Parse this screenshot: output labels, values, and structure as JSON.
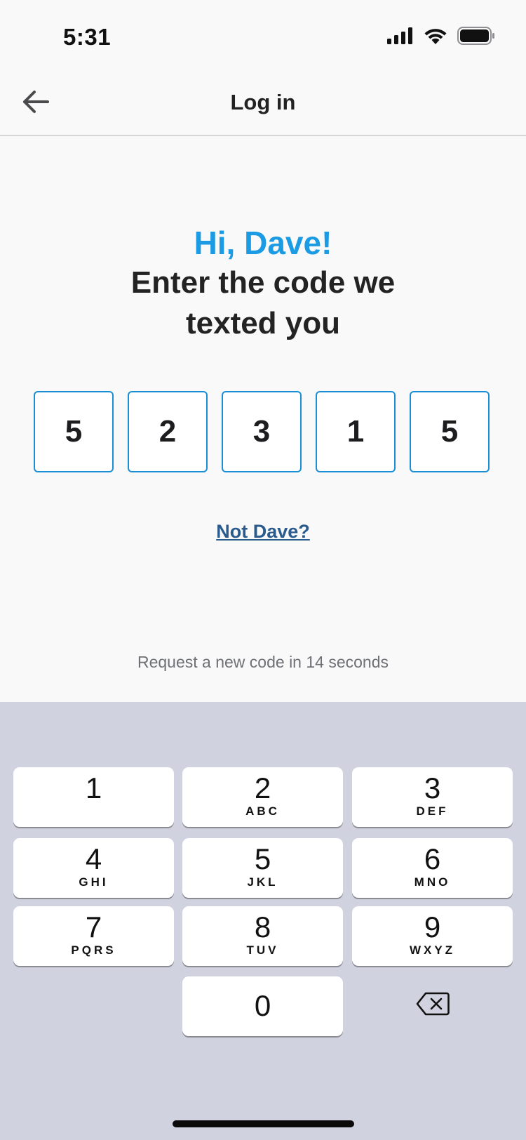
{
  "status_bar": {
    "time": "5:31",
    "icons": [
      "cellular-signal-icon",
      "wifi-icon",
      "battery-icon"
    ]
  },
  "nav": {
    "title": "Log in",
    "back_icon": "arrow-left-icon"
  },
  "heading": {
    "greeting": "Hi, Dave!",
    "instruction": "Enter the code we texted you"
  },
  "code": {
    "digits": [
      "5",
      "2",
      "3",
      "1",
      "5"
    ]
  },
  "not_user_link": "Not Dave?",
  "resend_text": "Request a new code in 14 seconds",
  "keyboard": {
    "keys": [
      {
        "digit": "1",
        "letters": ""
      },
      {
        "digit": "2",
        "letters": "ABC"
      },
      {
        "digit": "3",
        "letters": "DEF"
      },
      {
        "digit": "4",
        "letters": "GHI"
      },
      {
        "digit": "5",
        "letters": "JKL"
      },
      {
        "digit": "6",
        "letters": "MNO"
      },
      {
        "digit": "7",
        "letters": "PQRS"
      },
      {
        "digit": "8",
        "letters": "TUV"
      },
      {
        "digit": "9",
        "letters": "WXYZ"
      },
      {
        "digit": "0",
        "letters": ""
      }
    ],
    "delete_icon": "backspace-icon"
  },
  "colors": {
    "accent": "#1a9be3",
    "link": "#2a5b8f",
    "code_border": "#1a8fd6",
    "keyboard_bg": "#d0d3df"
  }
}
